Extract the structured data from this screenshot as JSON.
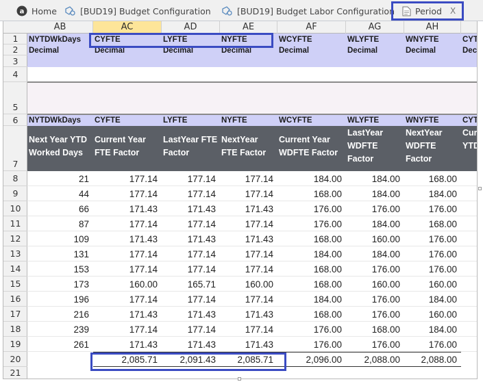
{
  "tabs": [
    {
      "label": "Home",
      "icon": "app-logo-icon"
    },
    {
      "label": "[BUD19] Budget Configuration",
      "icon": "config-icon"
    },
    {
      "label": "[BUD19] Budget Labor Configuration",
      "icon": "config-icon"
    },
    {
      "label": "Period",
      "icon": "document-icon",
      "close": "X"
    }
  ],
  "columns": [
    "AB",
    "AC",
    "AD",
    "AE",
    "AF",
    "AG",
    "AH"
  ],
  "active_column": "AC",
  "row_numbers": [
    "1",
    "2",
    "3",
    "4",
    "5",
    "6",
    "7",
    "8",
    "9",
    "10",
    "11",
    "12",
    "13",
    "14",
    "15",
    "16",
    "17",
    "18",
    "19",
    "20",
    "21"
  ],
  "row1_codes": [
    "NYTDWkDays",
    "CYFTE",
    "LYFTE",
    "NYFTE",
    "WCYFTE",
    "WLYFTE",
    "WNYFTE",
    "CYT"
  ],
  "row2_types": [
    "Decimal",
    "Decimal",
    "Decimal",
    "Decimal",
    "Decimal",
    "Decimal",
    "Decimal",
    "Deci"
  ],
  "row6_codes": [
    "NYTDWkDays",
    "CYFTE",
    "LYFTE",
    "NYFTE",
    "WCYFTE",
    "WLYFTE",
    "WNYFTE",
    "CYTI"
  ],
  "row7_headers": [
    "Next Year YTD Worked Days",
    "Current Year FTE Factor",
    "LastYear FTE Factor",
    "NextYear FTE Factor",
    "Current Year WDFTE Factor",
    "LastYear WDFTE Factor",
    "NextYear WDFTE Factor",
    "Cur YTD"
  ],
  "data_rows": [
    [
      "21",
      "177.14",
      "177.14",
      "177.14",
      "184.00",
      "184.00",
      "168.00"
    ],
    [
      "44",
      "177.14",
      "177.14",
      "177.14",
      "168.00",
      "184.00",
      "184.00"
    ],
    [
      "66",
      "171.43",
      "171.43",
      "171.43",
      "176.00",
      "176.00",
      "176.00"
    ],
    [
      "87",
      "177.14",
      "177.14",
      "177.14",
      "176.00",
      "184.00",
      "168.00"
    ],
    [
      "109",
      "171.43",
      "171.43",
      "171.43",
      "168.00",
      "160.00",
      "176.00"
    ],
    [
      "131",
      "177.14",
      "177.14",
      "177.14",
      "184.00",
      "184.00",
      "176.00"
    ],
    [
      "153",
      "177.14",
      "177.14",
      "177.14",
      "168.00",
      "176.00",
      "176.00"
    ],
    [
      "173",
      "160.00",
      "165.71",
      "160.00",
      "168.00",
      "160.00",
      "160.00"
    ],
    [
      "196",
      "177.14",
      "177.14",
      "177.14",
      "184.00",
      "176.00",
      "184.00"
    ],
    [
      "216",
      "171.43",
      "171.43",
      "171.43",
      "168.00",
      "176.00",
      "160.00"
    ],
    [
      "239",
      "177.14",
      "177.14",
      "177.14",
      "176.00",
      "168.00",
      "184.00"
    ],
    [
      "261",
      "171.43",
      "171.43",
      "171.43",
      "176.00",
      "176.00",
      "176.00"
    ]
  ],
  "totals": [
    "",
    "2,085.71",
    "2,091.43",
    "2,085.71",
    "2,096.00",
    "2,088.00",
    "2,088.00"
  ],
  "colors": {
    "accent_outline": "#3a4bc2",
    "header_dark": "#5b5f66",
    "lavender": "#cfd0f7",
    "active_col": "#fde599"
  }
}
